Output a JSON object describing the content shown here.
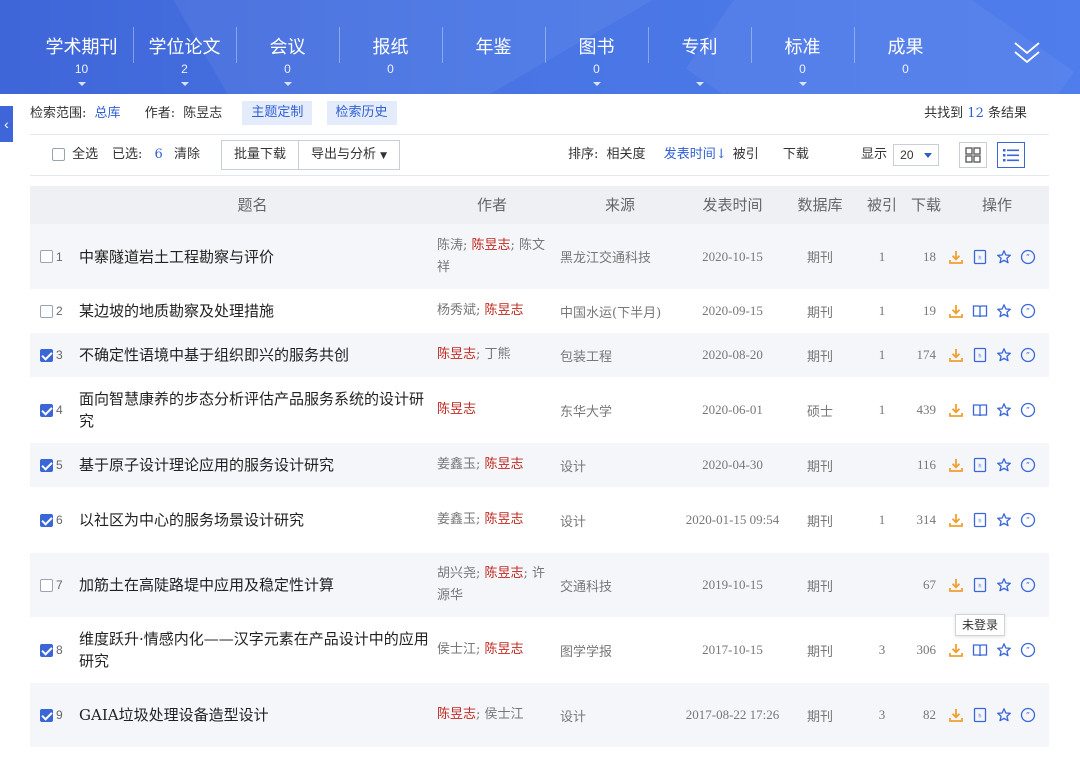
{
  "nav": {
    "tabs": [
      {
        "label": "学术期刊",
        "count": "10",
        "arrow": true
      },
      {
        "label": "学位论文",
        "count": "2",
        "arrow": true
      },
      {
        "label": "会议",
        "count": "0",
        "arrow": true
      },
      {
        "label": "报纸",
        "count": "0",
        "arrow": false
      },
      {
        "label": "年鉴",
        "count": "",
        "arrow": false
      },
      {
        "label": "图书",
        "count": "0",
        "arrow": true
      },
      {
        "label": "专利",
        "count": "",
        "arrow": true
      },
      {
        "label": "标准",
        "count": "0",
        "arrow": true
      },
      {
        "label": "成果",
        "count": "0",
        "arrow": false
      }
    ]
  },
  "scope": {
    "range_label": "检索范围:",
    "range_value": "总库",
    "author_label": "作者:",
    "author_value": "陈昱志",
    "theme_btn": "主题定制",
    "history_btn": "检索历史",
    "result_prefix": "共找到",
    "result_count": "12",
    "result_suffix": "条结果"
  },
  "toolbar": {
    "select_all": "全选",
    "selected_label": "已选:",
    "selected_count": "6",
    "clear": "清除",
    "batch_download": "批量下载",
    "export": "导出与分析",
    "sort_label": "排序:",
    "sort_relevance": "相关度",
    "sort_date": "发表时间",
    "sort_cite": "被引",
    "sort_download": "下载",
    "display_label": "显示",
    "page_size": "20"
  },
  "table": {
    "headers": {
      "title": "题名",
      "author": "作者",
      "source": "来源",
      "date": "发表时间",
      "db": "数据库",
      "cite": "被引",
      "download": "下载",
      "ops": "操作"
    },
    "rows": [
      {
        "no": "1",
        "checked": false,
        "title": "中寨隧道岩土工程勘察与评价",
        "authors_pre": "陈涛; ",
        "authors_hl": "陈昱志",
        "authors_post": "; 陈文祥",
        "source": "黑龙江交通科技",
        "date": "2020-10-15",
        "db": "期刊",
        "cite": "1",
        "download": "18",
        "reader": "html"
      },
      {
        "no": "2",
        "checked": false,
        "title": "某边坡的地质勘察及处理措施",
        "authors_pre": "杨秀斌; ",
        "authors_hl": "陈昱志",
        "authors_post": "",
        "source": "中国水运(下半月)",
        "date": "2020-09-15",
        "db": "期刊",
        "cite": "1",
        "download": "19",
        "reader": "book"
      },
      {
        "no": "3",
        "checked": true,
        "title": "不确定性语境中基于组织即兴的服务共创",
        "authors_pre": "",
        "authors_hl": "陈昱志",
        "authors_post": "; 丁熊",
        "source": "包装工程",
        "date": "2020-08-20",
        "db": "期刊",
        "cite": "1",
        "download": "174",
        "reader": "html"
      },
      {
        "no": "4",
        "checked": true,
        "title": "面向智慧康养的步态分析评估产品服务系统的设计研究",
        "authors_pre": "",
        "authors_hl": "陈昱志",
        "authors_post": "",
        "source": "东华大学",
        "date": "2020-06-01",
        "db": "硕士",
        "cite": "1",
        "download": "439",
        "reader": "book"
      },
      {
        "no": "5",
        "checked": true,
        "title": "基于原子设计理论应用的服务设计研究",
        "authors_pre": "姜鑫玉; ",
        "authors_hl": "陈昱志",
        "authors_post": "",
        "source": "设计",
        "date": "2020-04-30",
        "db": "期刊",
        "cite": "",
        "download": "116",
        "reader": "html"
      },
      {
        "no": "6",
        "checked": true,
        "title": "以社区为中心的服务场景设计研究",
        "authors_pre": "姜鑫玉; ",
        "authors_hl": "陈昱志",
        "authors_post": "",
        "source": "设计",
        "date": "2020-01-15 09:54",
        "db": "期刊",
        "cite": "1",
        "download": "314",
        "reader": "html"
      },
      {
        "no": "7",
        "checked": false,
        "title": "加筋土在高陡路堤中应用及稳定性计算",
        "authors_pre": "胡兴尧; ",
        "authors_hl": "陈昱志",
        "authors_post": "; 许源华",
        "source": "交通科技",
        "date": "2019-10-15",
        "db": "期刊",
        "cite": "",
        "download": "67",
        "reader": "html"
      },
      {
        "no": "8",
        "checked": true,
        "title": "维度跃升·情感内化——汉字元素在产品设计中的应用研究",
        "authors_pre": "侯士江; ",
        "authors_hl": "陈昱志",
        "authors_post": "",
        "source": "图学学报",
        "date": "2017-10-15",
        "db": "期刊",
        "cite": "3",
        "download": "306",
        "reader": "book"
      },
      {
        "no": "9",
        "checked": true,
        "title": "GAIA垃圾处理设备造型设计",
        "authors_pre": "",
        "authors_hl": "陈昱志",
        "authors_post": "; 侯士江",
        "source": "设计",
        "date": "2017-08-22 17:26",
        "db": "期刊",
        "cite": "3",
        "download": "82",
        "reader": "html"
      }
    ]
  },
  "tooltip": "未登录",
  "colors": {
    "brand": "#3f66d8",
    "highlight_author": "#c0281f",
    "download_icon": "#f0a030"
  }
}
